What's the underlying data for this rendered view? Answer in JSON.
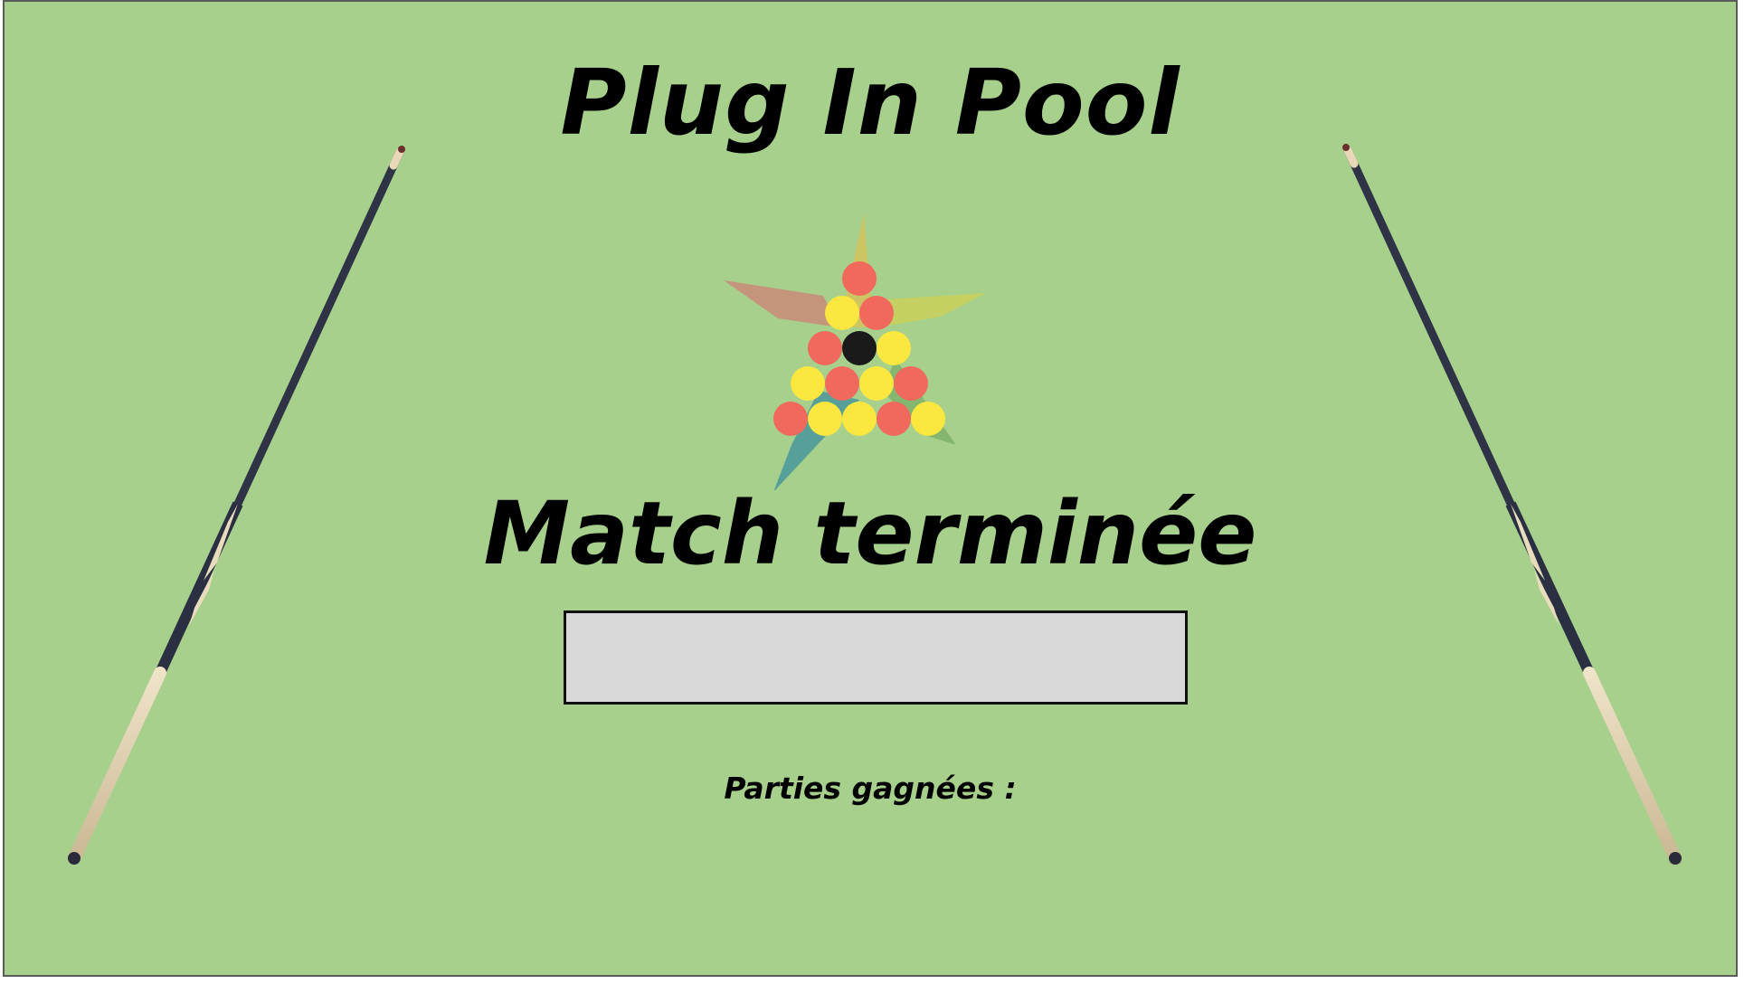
{
  "app": {
    "title": "Plug In Pool"
  },
  "game_over": {
    "heading": "Match terminée",
    "winner_value": "",
    "wins_label": "Parties gagnées :"
  },
  "icons": {
    "logo": "billiard-balls-rack-star-logo",
    "left_cue": "pool-cue-icon",
    "right_cue": "pool-cue-icon"
  },
  "colors": {
    "table_green": "#a7d08c",
    "ball_red": "#f0695c",
    "ball_yellow": "#fbe73f",
    "ball_black": "#1a1a1a",
    "field_gray": "#d9d9d9"
  }
}
